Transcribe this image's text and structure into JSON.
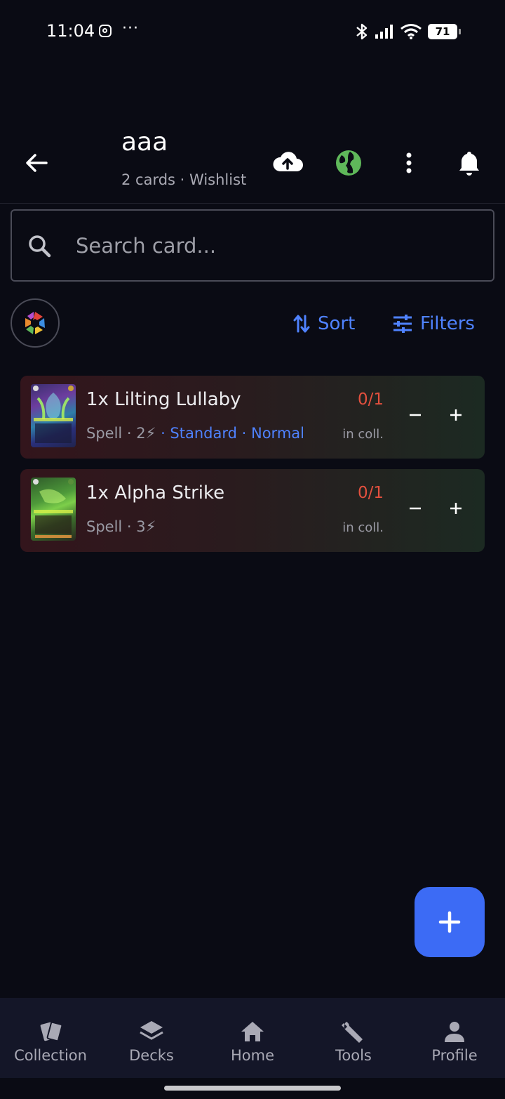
{
  "status_bar": {
    "time": "11:04",
    "more": "···",
    "battery": "71"
  },
  "header": {
    "title": "aaa",
    "subtitle": "2 cards · Wishlist",
    "icons": [
      "back-arrow-icon",
      "cloud-upload-icon",
      "globe-icon",
      "more-vertical-icon",
      "bell-icon"
    ],
    "globe_color": "#5fb85a"
  },
  "search": {
    "placeholder": "Search card...",
    "value": ""
  },
  "toolbar": {
    "sort_label": "Sort",
    "filters_label": "Filters",
    "accent": "#4f82ff"
  },
  "cards": [
    {
      "name": "1x Lilting Lullaby",
      "type": "Spell",
      "cost": "2⚡",
      "tags": [
        "Standard",
        "Normal"
      ],
      "owned": "0/1",
      "owned_label": "in coll."
    },
    {
      "name": "1x Alpha Strike",
      "type": "Spell",
      "cost": "3⚡",
      "tags": [],
      "owned": "0/1",
      "owned_label": "in coll."
    }
  ],
  "nav": {
    "items": [
      {
        "label": "Collection",
        "icon": "cards-icon"
      },
      {
        "label": "Decks",
        "icon": "layers-icon"
      },
      {
        "label": "Home",
        "icon": "home-icon"
      },
      {
        "label": "Tools",
        "icon": "wrench-icon"
      },
      {
        "label": "Profile",
        "icon": "person-icon"
      }
    ]
  }
}
